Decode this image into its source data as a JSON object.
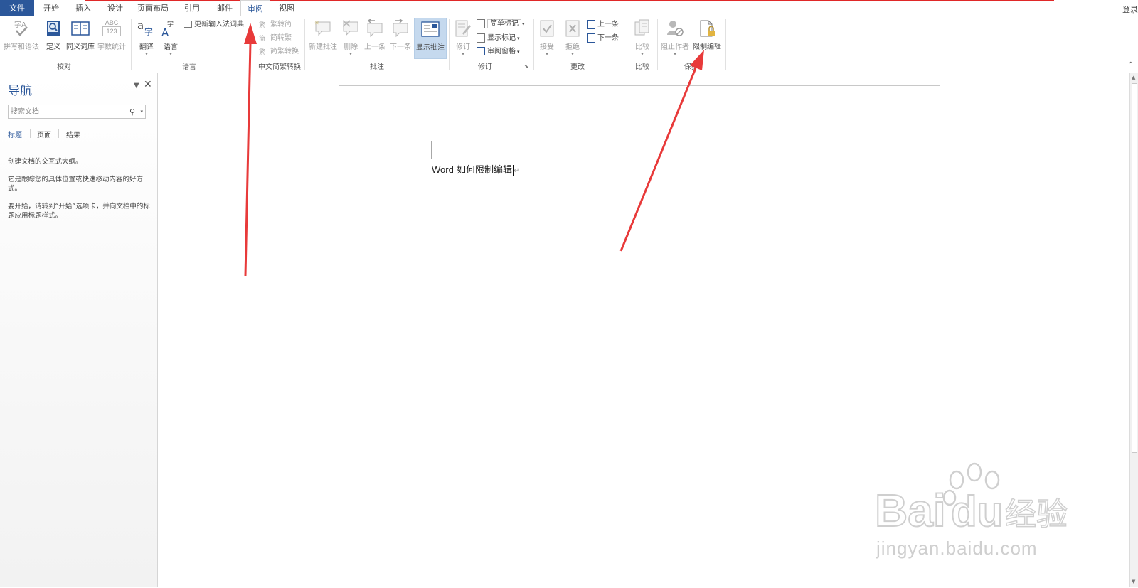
{
  "tabs": {
    "file": "文件",
    "home": "开始",
    "insert": "插入",
    "design": "设计",
    "page_layout": "页面布局",
    "references": "引用",
    "mailings": "邮件",
    "review": "审阅",
    "view": "视图",
    "active": "审阅"
  },
  "login": "登录",
  "ribbon": {
    "proofing": {
      "label": "校对",
      "spelling": "拼写和语法",
      "define": "定义",
      "thesaurus": "同义词库",
      "word_count": "字数统计",
      "word_count_icon_top": "ABC",
      "word_count_icon_bottom": "123"
    },
    "language": {
      "label": "语言",
      "translate": "翻译",
      "language": "语言",
      "update_ime": "更新输入法词典"
    },
    "chinese_conversion": {
      "label": "中文简繁转换",
      "to_simplified": "繁转简",
      "to_traditional": "简转繁",
      "convert": "简繁转换"
    },
    "comments": {
      "label": "批注",
      "new": "新建批注",
      "delete": "删除",
      "previous": "上一条",
      "next": "下一条",
      "show": "显示批注"
    },
    "tracking": {
      "label": "修订",
      "track_changes": "修订",
      "simple_markup": "简单标记",
      "show_markup": "显示标记",
      "reviewing_pane": "审阅窗格"
    },
    "changes": {
      "label": "更改",
      "accept": "接受",
      "reject": "拒绝",
      "previous": "上一条",
      "next": "下一条"
    },
    "compare": {
      "label": "比较",
      "compare": "比较"
    },
    "protect": {
      "label": "保护",
      "block_authors": "阻止作者",
      "restrict_editing": "限制编辑"
    }
  },
  "nav": {
    "title": "导航",
    "search_placeholder": "搜索文档",
    "tabs": [
      "标题",
      "页面",
      "结果"
    ],
    "active_tab": "标题",
    "text1": "创建文档的交互式大纲。",
    "text2": "它是跟踪您的具体位置或快速移动内容的好方式。",
    "text3": "要开始，请转到“开始”选项卡，并向文档中的标题应用标题样式。"
  },
  "document": {
    "latin": "Word",
    "chinese": "如何限制编辑"
  },
  "watermark": {
    "brand": "Bai",
    "brand_tail": "du",
    "cn": "经验",
    "url": "jingyan.baidu.com"
  },
  "colors": {
    "accent": "#2b579a",
    "arrow": "#e83a3a",
    "highlight": "#c5d9ee"
  }
}
